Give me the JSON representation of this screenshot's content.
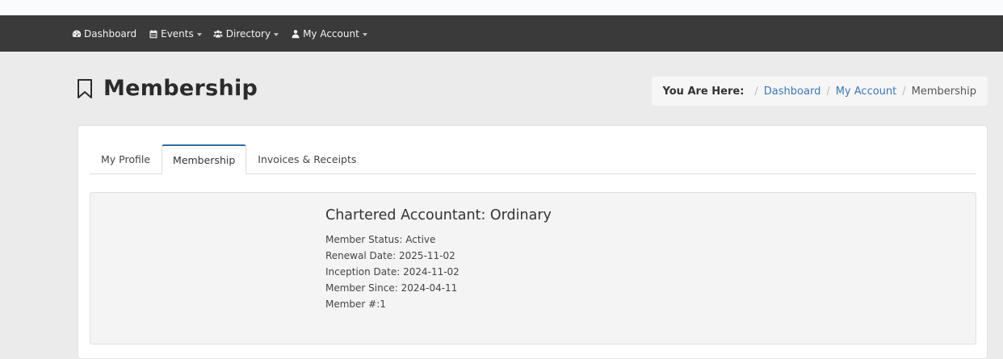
{
  "nav": {
    "items": [
      {
        "label": "Dashboard",
        "icon": "dashboard-icon",
        "has_dropdown": false
      },
      {
        "label": "Events",
        "icon": "calendar-icon",
        "has_dropdown": true
      },
      {
        "label": "Directory",
        "icon": "users-icon",
        "has_dropdown": true
      },
      {
        "label": "My Account",
        "icon": "user-icon",
        "has_dropdown": true
      }
    ]
  },
  "page": {
    "title": "Membership",
    "title_icon": "bookmark-icon"
  },
  "breadcrumb": {
    "label": "You Are Here:",
    "items": [
      "Dashboard",
      "My Account",
      "Membership"
    ]
  },
  "tabs": [
    {
      "label": "My Profile",
      "active": false
    },
    {
      "label": "Membership",
      "active": true
    },
    {
      "label": "Invoices & Receipts",
      "active": false
    }
  ],
  "membership": {
    "title": "Chartered Accountant: Ordinary",
    "details": [
      "Member Status: Active",
      "Renewal Date: 2025-11-02",
      "Inception Date: 2024-11-02",
      "Member Since: 2024-04-11",
      "Member #:1"
    ]
  },
  "colors": {
    "navbar": "#3a3a3a",
    "link": "#3b78b5",
    "active_tab_accent": "#2d6ea8"
  }
}
